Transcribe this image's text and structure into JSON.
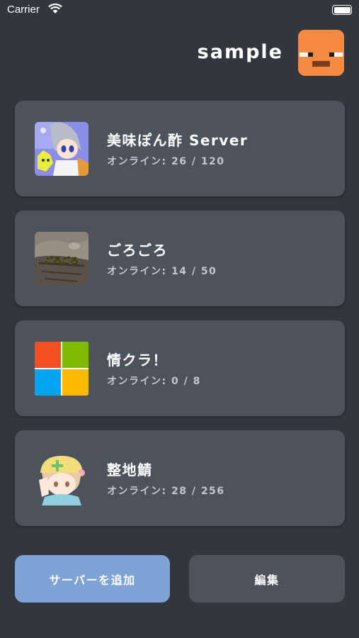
{
  "status_bar": {
    "carrier": "Carrier",
    "wifi_icon": "wifi-icon",
    "battery_icon": "battery-icon"
  },
  "header": {
    "username": "sample",
    "avatar_icon": "player-face-avatar",
    "avatar_color": "#f58a42"
  },
  "servers": [
    {
      "name": "美味ぽん酢 Server",
      "online": "オンライン: 26 / 120",
      "icon": "anime-character-icon"
    },
    {
      "name": "ごろごろ",
      "online": "オンライン: 14 / 50",
      "icon": "cat-photo-icon",
      "icon_caption": "ごろごろ"
    },
    {
      "name": "情クラ！",
      "online": "オンライン: 0 / 8",
      "icon": "windows-logo-icon"
    },
    {
      "name": "整地鯖",
      "online": "オンライン: 28 / 256",
      "icon": "chibi-character-icon"
    }
  ],
  "actions": {
    "add_server": "サーバーを追加",
    "edit": "編集"
  },
  "colors": {
    "background": "#32373e",
    "card": "#4c535c",
    "primary_button": "#7ea3d4",
    "muted_text": "#c3c7cc"
  }
}
